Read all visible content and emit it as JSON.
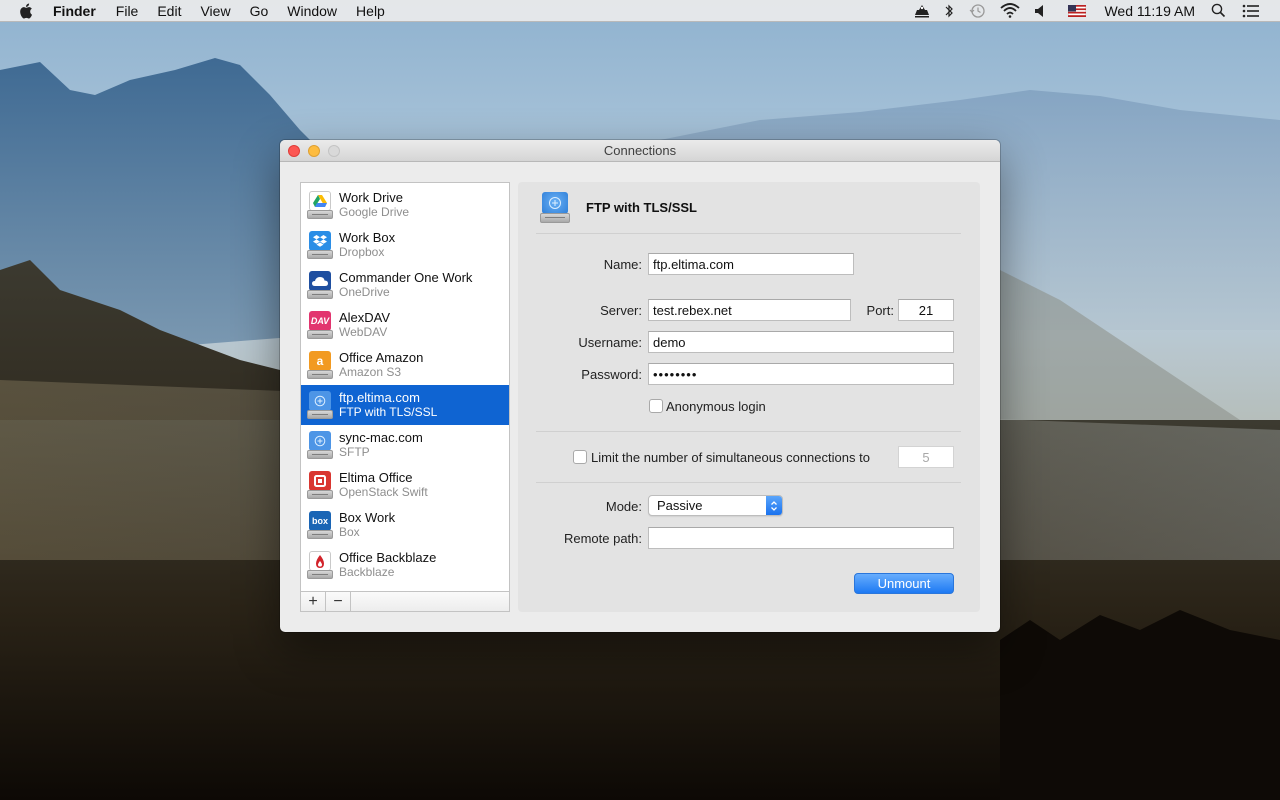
{
  "menubar": {
    "app_name": "Finder",
    "items": [
      "File",
      "Edit",
      "View",
      "Go",
      "Window",
      "Help"
    ],
    "status_icons": [
      "tunnelblick-icon",
      "bluetooth-icon",
      "time-machine-icon",
      "wifi-icon",
      "volume-icon",
      "us-flag-input-icon"
    ],
    "clock": "Wed 11:19 AM"
  },
  "window": {
    "title": "Connections"
  },
  "connections": [
    {
      "name": "Work Drive",
      "type": "Google Drive",
      "icon": "google-drive-icon",
      "color": "#ffffff",
      "selected": false
    },
    {
      "name": "Work Box",
      "type": "Dropbox",
      "icon": "dropbox-icon",
      "color": "#2b8ee6",
      "selected": false
    },
    {
      "name": "Commander One Work",
      "type": "OneDrive",
      "icon": "onedrive-icon",
      "color": "#1f4fa0",
      "selected": false
    },
    {
      "name": "AlexDAV",
      "type": "WebDAV",
      "icon": "webdav-icon",
      "color": "#e2356f",
      "selected": false
    },
    {
      "name": "Office Amazon",
      "type": "Amazon S3",
      "icon": "amazon-s3-icon",
      "color": "#f29a21",
      "selected": false
    },
    {
      "name": "ftp.eltima.com",
      "type": "FTP with TLS/SSL",
      "icon": "ftp-icon",
      "color": "#4d95e6",
      "selected": true
    },
    {
      "name": "sync-mac.com",
      "type": "SFTP",
      "icon": "sftp-icon",
      "color": "#4d95e6",
      "selected": false
    },
    {
      "name": "Eltima Office",
      "type": "OpenStack Swift",
      "icon": "openstack-icon",
      "color": "#d93731",
      "selected": false
    },
    {
      "name": "Box Work",
      "type": "Box",
      "icon": "box-icon",
      "color": "#1a65b5",
      "selected": false
    },
    {
      "name": "Office Backblaze",
      "type": "Backblaze",
      "icon": "backblaze-icon",
      "color": "#ffffff",
      "selected": false
    }
  ],
  "list_footer": {
    "add_label": "+",
    "remove_label": "−"
  },
  "detail": {
    "title": "FTP with TLS/SSL",
    "name_label": "Name:",
    "name_value": "ftp.eltima.com",
    "server_label": "Server:",
    "server_value": "test.rebex.net",
    "port_label": "Port:",
    "port_value": "21",
    "username_label": "Username:",
    "username_value": "demo",
    "password_label": "Password:",
    "password_value": "••••••••",
    "anonymous_label": "Anonymous login",
    "anonymous_checked": false,
    "limit_label": "Limit the number of simultaneous connections to",
    "limit_checked": false,
    "limit_value": "5",
    "mode_label": "Mode:",
    "mode_value": "Passive",
    "remote_path_label": "Remote path:",
    "remote_path_value": "",
    "unmount_label": "Unmount"
  },
  "colors": {
    "selection": "#0f64d2",
    "primary_button": "#1d79f3"
  }
}
